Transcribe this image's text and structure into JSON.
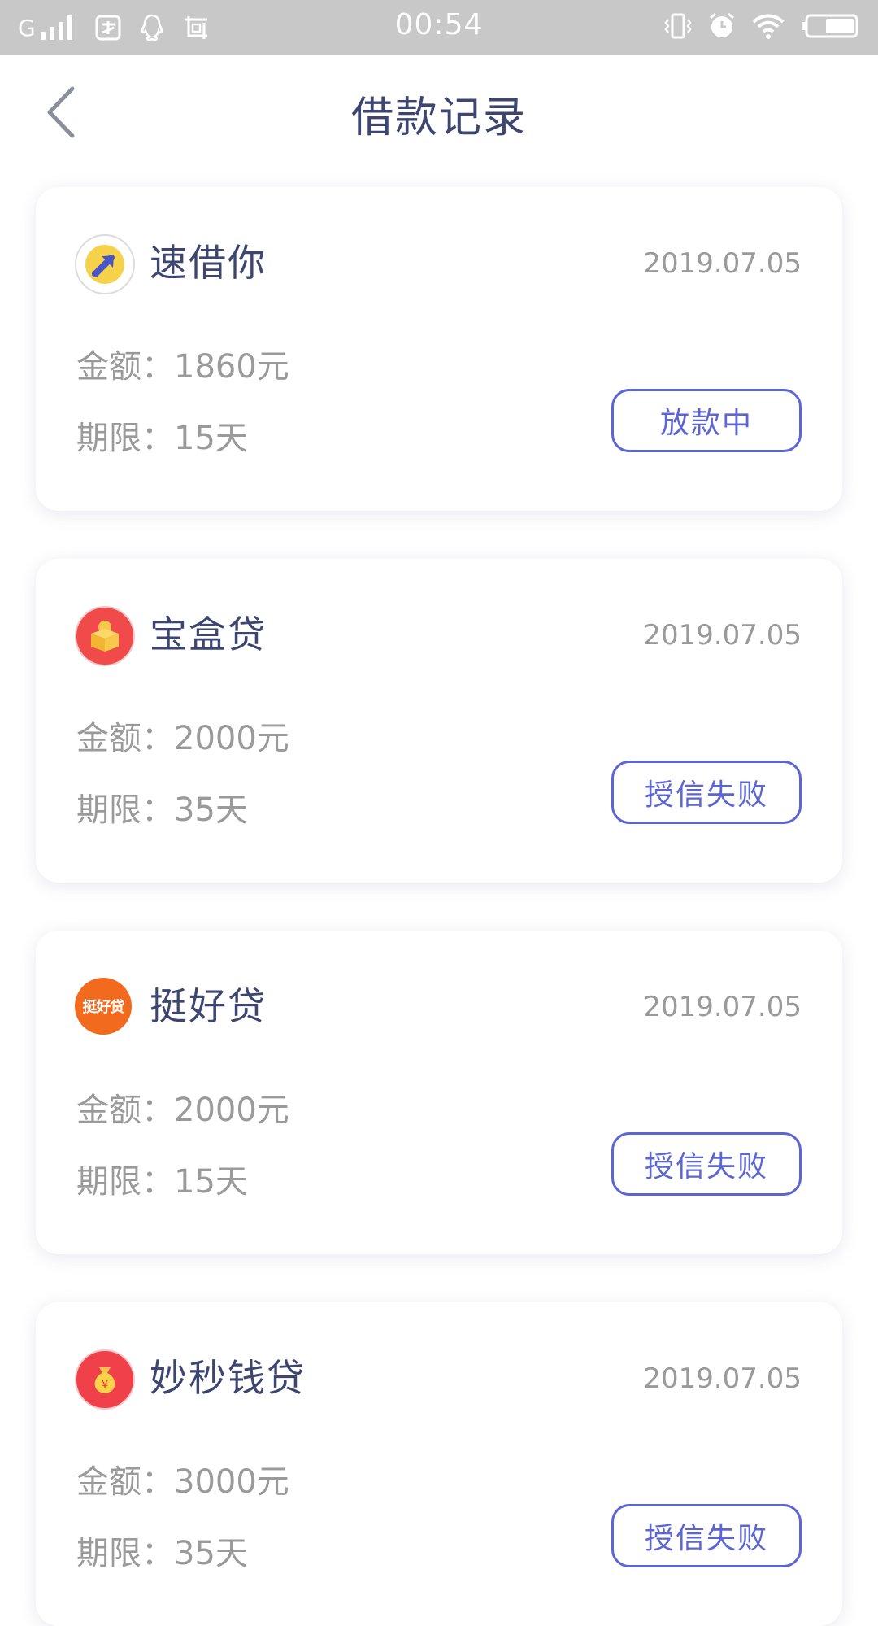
{
  "status_bar": {
    "carrier": "G",
    "time": "00:54"
  },
  "nav": {
    "title": "借款记录"
  },
  "records": [
    {
      "name": "速借你",
      "date": "2019.07.05",
      "amount": "金额：1860元",
      "term": "期限：15天",
      "status": "放款中",
      "logo_color": "#f6d24a"
    },
    {
      "name": "宝盒贷",
      "date": "2019.07.05",
      "amount": "金额：2000元",
      "term": "期限：35天",
      "status": "授信失败",
      "logo_color": "#f04a4a"
    },
    {
      "name": "挺好贷",
      "date": "2019.07.05",
      "amount": "金额：2000元",
      "term": "期限：15天",
      "status": "授信失败",
      "logo_color": "#f26a1d",
      "logo_text": "挺好贷"
    },
    {
      "name": "妙秒钱贷",
      "date": "2019.07.05",
      "amount": "金额：3000元",
      "term": "期限：35天",
      "status": "授信失败",
      "logo_color": "#f0414a"
    }
  ],
  "colors": {
    "accent": "#5b65d6",
    "title": "#3c4670",
    "muted": "#9a9a9a",
    "status_bar": "#c8c8c8"
  }
}
